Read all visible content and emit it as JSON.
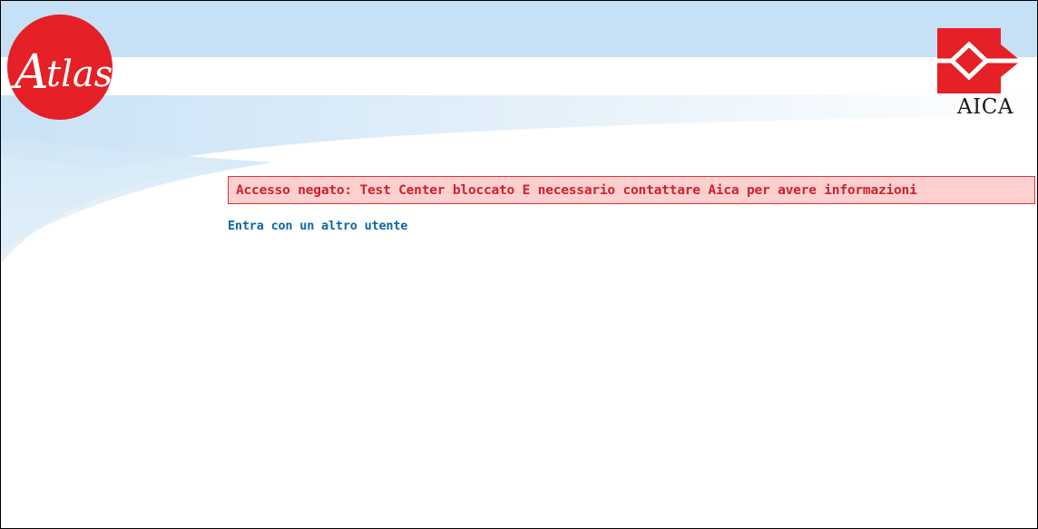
{
  "header": {
    "left_logo": {
      "icon": "atlas-logo",
      "text": "Atlas",
      "color": "#e52026"
    },
    "right_logo": {
      "icon": "aica-logo",
      "text": "AICA",
      "color": "#e52026"
    },
    "band_color_light": "#c6e1f5"
  },
  "main": {
    "error_message": "Accesso negato: Test Center bloccato E necessario contattare Aica per avere informazioni",
    "error_colors": {
      "background": "#fdd0d0",
      "border": "#d9343e",
      "text": "#d0202e"
    },
    "alt_user_link": "Entra con un altro utente",
    "link_color": "#0a67a3"
  }
}
